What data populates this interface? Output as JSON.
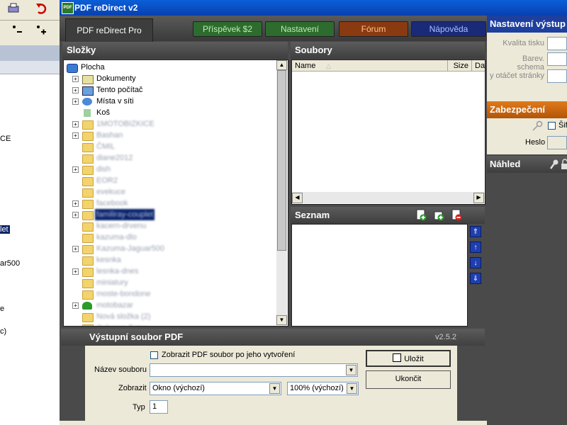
{
  "window": {
    "title": "PDF reDirect v2"
  },
  "topbar": {
    "brand": "PDF reDirect Pro",
    "nav": [
      {
        "label": "Příspěvek $2",
        "color": "#2e6b2e",
        "text": "#b9f0b0"
      },
      {
        "label": "Nastavení",
        "color": "#2e6b2e",
        "text": "#b9f0b0"
      },
      {
        "label": "Fórum",
        "color": "#8a3a10",
        "text": "#ffc38a"
      },
      {
        "label": "Nápověda",
        "color": "#1a2a78",
        "text": "#a8c0ff"
      }
    ]
  },
  "folders": {
    "title": "Složky",
    "items": [
      {
        "label": "Plocha",
        "icon": "desktop-icon",
        "level": 0,
        "expander": false,
        "blurred": false
      },
      {
        "label": "Dokumenty",
        "icon": "documents-icon",
        "level": 1,
        "expander": true,
        "blurred": false
      },
      {
        "label": "Tento počítač",
        "icon": "computer-icon",
        "level": 1,
        "expander": true,
        "blurred": false
      },
      {
        "label": "Místa v síti",
        "icon": "network-icon",
        "level": 1,
        "expander": true,
        "blurred": false
      },
      {
        "label": "Koš",
        "icon": "recycle-bin-icon",
        "level": 1,
        "expander": false,
        "blurred": false
      },
      {
        "label": "1MOTOBIZKICE",
        "icon": "folder-icon",
        "level": 1,
        "expander": true,
        "blurred": true
      },
      {
        "label": "Bashan",
        "icon": "folder-icon",
        "level": 1,
        "expander": true,
        "blurred": true
      },
      {
        "label": "ČMIL",
        "icon": "folder-icon",
        "level": 1,
        "expander": false,
        "blurred": true
      },
      {
        "label": "diane2012",
        "icon": "folder-icon",
        "level": 1,
        "expander": false,
        "blurred": true
      },
      {
        "label": "dish",
        "icon": "folder-icon",
        "level": 1,
        "expander": true,
        "blurred": true
      },
      {
        "label": "EOR2",
        "icon": "folder-icon",
        "level": 1,
        "expander": false,
        "blurred": true
      },
      {
        "label": "evekuce",
        "icon": "folder-icon",
        "level": 1,
        "expander": false,
        "blurred": true
      },
      {
        "label": "facebook",
        "icon": "folder-icon",
        "level": 1,
        "expander": true,
        "blurred": true
      },
      {
        "label": "familiray-couplet",
        "icon": "folder-icon",
        "level": 1,
        "expander": true,
        "blurred": true,
        "selected": true
      },
      {
        "label": "kacern-drvenu",
        "icon": "folder-icon",
        "level": 1,
        "expander": false,
        "blurred": true
      },
      {
        "label": "kazuma-dlo",
        "icon": "folder-icon",
        "level": 1,
        "expander": false,
        "blurred": true
      },
      {
        "label": "Kazuma-Jaguar500",
        "icon": "folder-icon",
        "level": 1,
        "expander": true,
        "blurred": true
      },
      {
        "label": "kesnka",
        "icon": "folder-icon",
        "level": 1,
        "expander": false,
        "blurred": true
      },
      {
        "label": "lesnka-dnes",
        "icon": "folder-icon",
        "level": 1,
        "expander": true,
        "blurred": true
      },
      {
        "label": "miniatury",
        "icon": "folder-icon",
        "level": 1,
        "expander": false,
        "blurred": true
      },
      {
        "label": "moste-bondone",
        "icon": "folder-icon",
        "level": 1,
        "expander": false,
        "blurred": true
      },
      {
        "label": "motobazar",
        "icon": "tree-icon",
        "level": 1,
        "expander": true,
        "blurred": true
      },
      {
        "label": "Nová složka (2)",
        "icon": "folder-icon",
        "level": 1,
        "expander": false,
        "blurred": true
      },
      {
        "label": "Ochrana Fotos",
        "icon": "folder-icon",
        "level": 1,
        "expander": false,
        "blurred": true
      }
    ]
  },
  "files": {
    "title": "Soubory",
    "columns": [
      "Name",
      "Size",
      "Da"
    ]
  },
  "list": {
    "title": "Seznam"
  },
  "output": {
    "title": "Výstupní soubor PDF",
    "version": "v2.5.2",
    "show_after_label": "Zobrazit PDF soubor po jeho vytvoření",
    "filename_label": "Název souboru",
    "filename_value": "",
    "display_label": "Zobrazit",
    "display_value": "Okno (výchozí)",
    "zoom_value": "100% (výchozí)",
    "type_label": "Typ",
    "type_value": "1",
    "save_label": "Uložit",
    "exit_label": "Ukončit"
  },
  "settings": {
    "title": "Nastavení výstup",
    "quality_label": "Kvalita tisku",
    "color_label": "Barev. schema",
    "rotate_label": "y otáčet stránky"
  },
  "security": {
    "title": "Zabezpečení",
    "encrypt_label": "Šif",
    "password_label": "Heslo"
  },
  "preview": {
    "title": "Náhled"
  },
  "background_app": {
    "lines": [
      "CE",
      "let",
      "ar500",
      "e",
      "c)"
    ]
  }
}
